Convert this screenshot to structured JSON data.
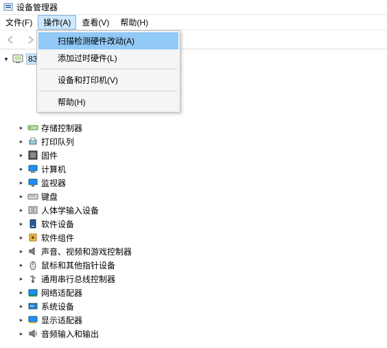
{
  "window": {
    "title": "设备管理器"
  },
  "menubar": {
    "items": [
      {
        "label": "文件(F)"
      },
      {
        "label": "操作(A)"
      },
      {
        "label": "查看(V)"
      },
      {
        "label": "帮助(H)"
      }
    ],
    "active_index": 1
  },
  "dropdown": {
    "items": [
      {
        "label": "扫描检测硬件改动(A)",
        "selected": true
      },
      {
        "label": "添加过时硬件(L)"
      },
      {
        "label": "设备和打印机(V)"
      },
      {
        "label": "帮助(H)"
      }
    ]
  },
  "tree": {
    "root": {
      "label": "83"
    },
    "children": [
      {
        "icon": "storage",
        "label": "存储控制器"
      },
      {
        "icon": "printer",
        "label": "打印队列"
      },
      {
        "icon": "firmware",
        "label": "固件"
      },
      {
        "icon": "computer",
        "label": "计算机"
      },
      {
        "icon": "monitor",
        "label": "监视器"
      },
      {
        "icon": "keyboard",
        "label": "键盘"
      },
      {
        "icon": "hid",
        "label": "人体学输入设备"
      },
      {
        "icon": "software",
        "label": "软件设备"
      },
      {
        "icon": "component",
        "label": "软件组件"
      },
      {
        "icon": "audio",
        "label": "声音、视频和游戏控制器"
      },
      {
        "icon": "mouse",
        "label": "鼠标和其他指针设备"
      },
      {
        "icon": "usb",
        "label": "通用串行总线控制器"
      },
      {
        "icon": "network",
        "label": "网络适配器"
      },
      {
        "icon": "system",
        "label": "系统设备"
      },
      {
        "icon": "display",
        "label": "显示适配器"
      },
      {
        "icon": "audioio",
        "label": "音频输入和输出"
      }
    ]
  }
}
